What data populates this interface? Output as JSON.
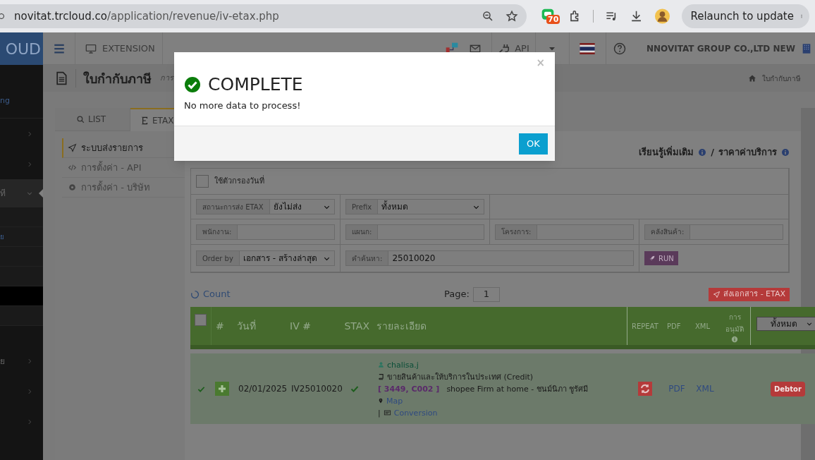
{
  "browser": {
    "url_host": "novitat.trcloud.co",
    "url_path": "/application/revenue/iv-etax.php",
    "extension_badge": "70",
    "relaunch": "Relaunch to update"
  },
  "app_header": {
    "logo": "OUD",
    "extension": "EXTENSION",
    "api": "API",
    "company": "NNOVITAT GROUP CO.,LTD NEW"
  },
  "sidebar": {
    "items": [
      {
        "kind": "link",
        "label": "ng",
        "selected": false
      },
      {
        "kind": "menu",
        "selected": false
      },
      {
        "kind": "menu",
        "selected": false
      },
      {
        "kind": "open",
        "label": "ที",
        "selected": true
      },
      {
        "kind": "sub",
        "selected": false
      },
      {
        "kind": "sub",
        "label": "ย",
        "selected": false
      },
      {
        "kind": "sub",
        "selected": false
      },
      {
        "kind": "sub",
        "selected": false
      },
      {
        "kind": "sub",
        "selected": true
      },
      {
        "kind": "sub",
        "selected": false
      },
      {
        "kind": "menu",
        "label": "ย",
        "selected": false
      },
      {
        "kind": "menu",
        "selected": false
      },
      {
        "kind": "menu",
        "selected": false
      }
    ]
  },
  "page_title": {
    "title": "ใบกำกับภาษี",
    "subtitle": "การ",
    "breadcrumb": "ใบกำกับภาษี"
  },
  "tabs": [
    {
      "label": "LIST",
      "selected": false
    },
    {
      "label": "ETAX",
      "selected": true
    }
  ],
  "side_nav": [
    {
      "label": "ระบบส่งรายการ",
      "selected": true
    },
    {
      "label": "การตั้งค่า - API",
      "selected": false
    },
    {
      "label": "การตั้งค่า - บริษัท",
      "selected": false
    }
  ],
  "help_links": {
    "learn_more": "เรียนรู้เพิ่มเติม",
    "separator": "/",
    "pricing": "ราคาค่าบริการ"
  },
  "filters": {
    "date_filter": {
      "label": "ใช้ตัวกรองวันที่",
      "checked": false
    },
    "status": {
      "label": "สถานะการส่ง ETAX",
      "value": "ยังไม่ส่ง"
    },
    "prefix": {
      "label": "Prefix",
      "value": "ทั้งหมด"
    },
    "employee": {
      "label": "พนักงาน:"
    },
    "department": {
      "label": "แผนก:"
    },
    "project": {
      "label": "โครงการ:"
    },
    "warehouse": {
      "label": "คลังสินค้า:"
    },
    "order_by": {
      "label": "Order by",
      "value": "เอกสาร - สร้างล่าสุด"
    },
    "search": {
      "label": "คำค้นหา:",
      "value": "25010020"
    },
    "run": "RUN"
  },
  "count_link": "Count",
  "page": {
    "label": "Page:",
    "value": "1"
  },
  "send_button": "ส่งเอกสาร - ETAX",
  "table": {
    "select_all_checked": false,
    "columns": [
      "#",
      "วันที่",
      "IV #",
      "STAX",
      "รายละเอียด",
      "REPEAT",
      "PDF",
      "XML",
      "การอนุมัติ"
    ],
    "filter_value": "ทั้งหมด",
    "rows": [
      {
        "sent": true,
        "date": "02/01/2025",
        "iv": "IV25010020",
        "stax": true,
        "user": "chalisa.j",
        "type": "ขายสินค้าและให้บริการในประเทศ (Credit)",
        "codes": "[ 3449, C002 ]",
        "customer": "shopee Firm at home - ชนม์นิภา ชูรัศมี",
        "map": "Map",
        "separator": "|",
        "conversion": "Conversion",
        "pdf": "PDF",
        "xml": "XML",
        "status": "Debtor"
      }
    ]
  },
  "modal": {
    "title": "COMPLETE",
    "message": "No more data to process!",
    "close": "×",
    "ok": "OK"
  }
}
